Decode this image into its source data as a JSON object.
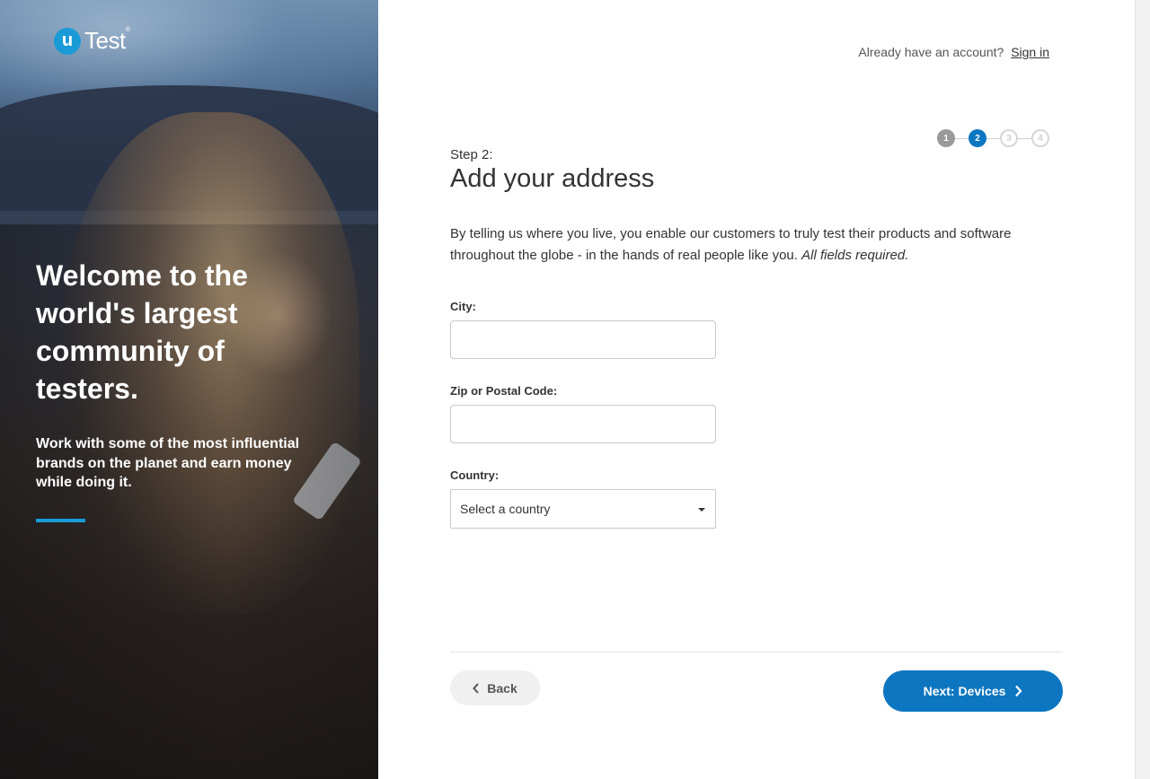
{
  "logo": {
    "mark": "u",
    "text": "Test",
    "tm": "®"
  },
  "hero": {
    "title": "Welcome to the world's largest community of testers.",
    "subtitle": "Work with some of the most influential brands on the planet and earn money while doing it."
  },
  "signin": {
    "prompt": "Already have an account?",
    "link": "Sign in"
  },
  "stepper": {
    "steps": [
      "1",
      "2",
      "3",
      "4"
    ],
    "current": 2
  },
  "form": {
    "step_label": "Step 2:",
    "title": "Add your address",
    "intro": "By telling us where you live, you enable our customers to truly test their products and software throughout the globe - in the hands of real people like you.",
    "intro_emphasis": "All fields required.",
    "city_label": "City:",
    "city_value": "",
    "zip_label": "Zip or Postal Code:",
    "zip_value": "",
    "country_label": "Country:",
    "country_value": "Select a country"
  },
  "buttons": {
    "back": "Back",
    "next": "Next: Devices"
  },
  "colors": {
    "accent": "#0d76c0",
    "brand": "#1a9bd7"
  }
}
